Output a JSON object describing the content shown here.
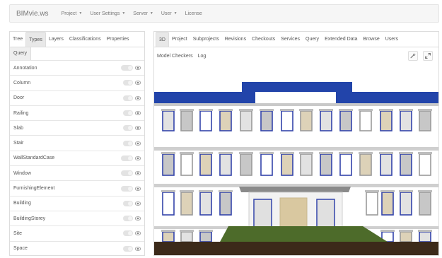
{
  "navbar": {
    "brand": "BIMvie.ws",
    "items": [
      {
        "label": "Project",
        "caret": true
      },
      {
        "label": "User Settings",
        "caret": true
      },
      {
        "label": "Server",
        "caret": true
      },
      {
        "label": "User",
        "caret": true
      },
      {
        "label": "License",
        "caret": false
      }
    ]
  },
  "left_panel": {
    "tabs": [
      "Tree",
      "Types",
      "Layers",
      "Classifications",
      "Properties"
    ],
    "active_tab": "Types",
    "subtab": "Query",
    "types": [
      {
        "name": "Annotation",
        "wide": true
      },
      {
        "name": "Column",
        "wide": false
      },
      {
        "name": "Door",
        "wide": false
      },
      {
        "name": "Railing",
        "wide": false
      },
      {
        "name": "Slab",
        "wide": false
      },
      {
        "name": "Stair",
        "wide": false
      },
      {
        "name": "WallStandardCase",
        "wide": true
      },
      {
        "name": "Window",
        "wide": true
      },
      {
        "name": "FurnishingElement",
        "wide": true
      },
      {
        "name": "Building",
        "wide": false
      },
      {
        "name": "BuildingStorey",
        "wide": false
      },
      {
        "name": "Site",
        "wide": false
      },
      {
        "name": "Space",
        "wide": false
      }
    ]
  },
  "right_panel": {
    "tabs": [
      "3D",
      "Project",
      "Subprojects",
      "Revisions",
      "Checkouts",
      "Services",
      "Query",
      "Extended Data",
      "Browse",
      "Users"
    ],
    "active_tab": "3D",
    "subtabs": [
      "Model Checkers",
      "Log"
    ],
    "tools": [
      "wrench-icon",
      "expand-icon"
    ]
  },
  "colors": {
    "roof_blue": "#2244aa",
    "window_blue": "#3344aa",
    "ground": "#3c2a1a",
    "lawn": "#4d6b2a",
    "wall": "#ffffff"
  }
}
